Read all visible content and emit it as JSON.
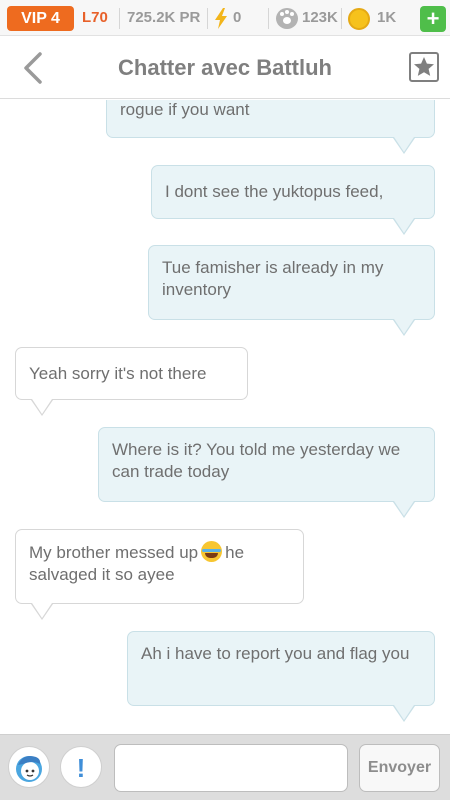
{
  "statusbar": {
    "vip": "VIP 4",
    "level": "L70",
    "power": "725.2K PR",
    "energy": "0",
    "paws": "123K",
    "coins": "1K",
    "add_label": "+"
  },
  "header": {
    "title": "Chatter avec Battluh"
  },
  "messages": [
    {
      "direction": "outgoing",
      "text": "rogue if you want"
    },
    {
      "direction": "outgoing",
      "text": "I dont see the yuktopus feed,"
    },
    {
      "direction": "outgoing",
      "text": "Tue famisher is already in my inventory"
    },
    {
      "direction": "incoming",
      "text": "Yeah sorry it's not there"
    },
    {
      "direction": "outgoing",
      "text": "Where is it? You told me yesterday we can trade today"
    },
    {
      "direction": "incoming",
      "text_before": "My brother messed up",
      "emoji": "crying-laughing-emoji",
      "text_after": "he salvaged it so ayee"
    },
    {
      "direction": "outgoing",
      "text": "Ah i have to report you and flag you"
    }
  ],
  "composer": {
    "input_value": "",
    "send_label": "Envoyer",
    "alert_label": "!"
  },
  "colors": {
    "vip_orange": "#ee6b1f",
    "outgoing_bubble": "#e9f4f7",
    "incoming_bubble": "#ffffff",
    "add_green": "#4fbe4a",
    "coin_gold": "#f6c21c"
  }
}
